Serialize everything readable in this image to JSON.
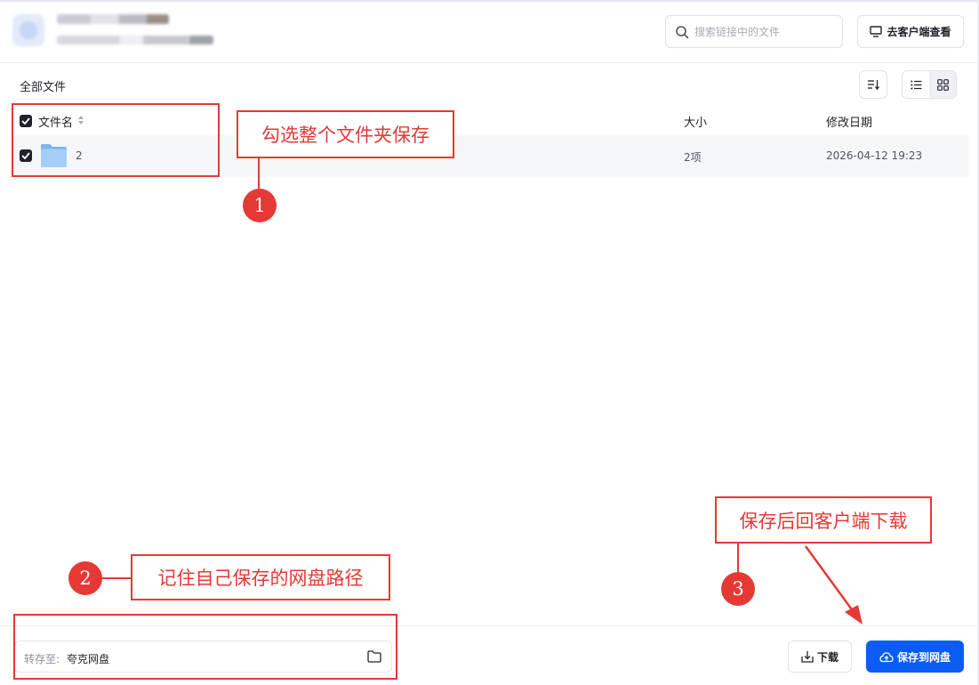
{
  "header": {
    "search_placeholder": "搜索链接中的文件",
    "client_button": "去客户端查看"
  },
  "toolbar": {
    "breadcrumb": "全部文件"
  },
  "table": {
    "columns": {
      "name": "文件名",
      "size": "大小",
      "modified": "修改日期"
    },
    "rows": [
      {
        "name": "2",
        "size": "2项",
        "modified": "2026-04-12 19:23",
        "checked": true
      }
    ]
  },
  "bottom": {
    "save_to_label": "转存至:",
    "save_to_value": "夸克网盘",
    "download_button": "下载",
    "save_button": "保存到网盘"
  },
  "annotations": {
    "note1": "勾选整个文件夹保存",
    "note2": "记住自己保存的网盘路径",
    "note3": "保存后回客户端下载",
    "badge1": "1",
    "badge2": "2",
    "badge3": "3"
  },
  "colors": {
    "accent": "#0a5cf5",
    "annotation": "#e53935"
  }
}
